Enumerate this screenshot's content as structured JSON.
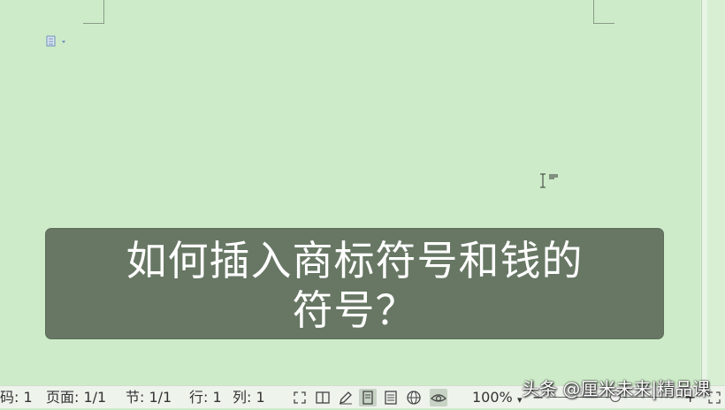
{
  "document": {
    "caption_line1": "如何插入商标符号和钱的",
    "caption_line2": "符号？"
  },
  "statusbar": {
    "page_code": "码: 1",
    "page": "页面: 1/1",
    "section": "节: 1/1",
    "row": "行: 1",
    "column": "列: 1",
    "zoom": "100%",
    "zoom_dropdown": "▾",
    "zoom_minus": "−",
    "zoom_plus": "+",
    "icons": [
      "fullscreen-icon",
      "reading-mode-icon",
      "edit-icon",
      "page-view-icon",
      "outline-view-icon",
      "web-view-icon",
      "eye-protection-icon"
    ]
  },
  "watermark": "头条 @厘米未来|精品课",
  "colors": {
    "page_background": "#cdebc8",
    "caption_background": "#677764",
    "caption_text": "#ffffff",
    "statusbar_background": "#eef3ec"
  }
}
